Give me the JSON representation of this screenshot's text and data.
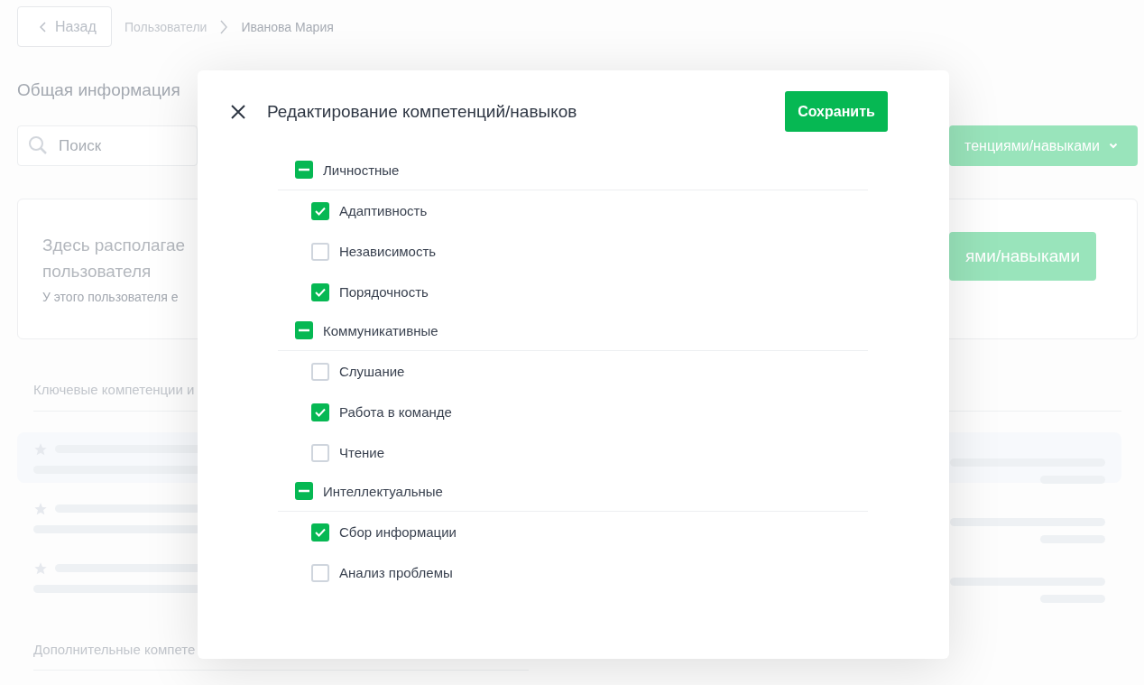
{
  "back_button": {
    "label": "Назад"
  },
  "breadcrumbs": [
    {
      "label": "Пользователи"
    },
    {
      "label": "Иванова Мария"
    }
  ],
  "section_title": "Общая информация",
  "search": {
    "placeholder": "Поиск"
  },
  "competencies_dropdown": {
    "label": "тенциями/навыками"
  },
  "info_card": {
    "title_lines": [
      "Здесь располагае",
      "пользователя"
    ],
    "subtitle": "У этого пользователя е",
    "button": "ями/навыками"
  },
  "key_section": {
    "title": "Ключевые компетенции и"
  },
  "extra_section": {
    "title": "Дополнительные компете"
  },
  "modal": {
    "title": "Редактирование компетенций/навыков",
    "save_button": "Сохранить",
    "groups": [
      {
        "label": "Личностные",
        "indeterminate": true,
        "children": [
          {
            "label": "Адаптивность",
            "checked": true
          },
          {
            "label": "Независимость",
            "checked": false
          },
          {
            "label": "Порядочность",
            "checked": true
          }
        ]
      },
      {
        "label": "Коммуникативные",
        "indeterminate": true,
        "children": [
          {
            "label": "Слушание",
            "checked": false
          },
          {
            "label": "Работа в команде",
            "checked": true
          },
          {
            "label": "Чтение",
            "checked": false
          }
        ]
      },
      {
        "label": "Интеллектуальные",
        "indeterminate": true,
        "children": [
          {
            "label": "Сбор информации",
            "checked": true
          },
          {
            "label": "Анализ проблемы",
            "checked": false
          }
        ]
      }
    ]
  }
}
